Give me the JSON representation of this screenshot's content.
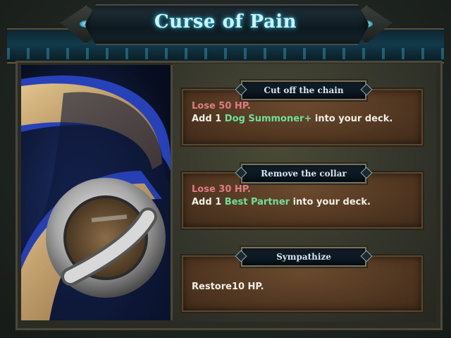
{
  "event": {
    "title": "Curse of Pain",
    "image_icon": "collar-icon"
  },
  "options": [
    {
      "label": "Cut off the chain",
      "line1": {
        "prefix": "",
        "highlight": "Lose 50 HP.",
        "suffix": ""
      },
      "line2": {
        "prefix": "Add 1 ",
        "highlight": "Dog Summoner+",
        "suffix": " into your deck."
      }
    },
    {
      "label": "Remove the collar",
      "line1": {
        "prefix": "",
        "highlight": "Lose 30 HP.",
        "suffix": ""
      },
      "line2": {
        "prefix": "Add 1 ",
        "highlight": "Best Partner",
        "suffix": " into your deck."
      }
    },
    {
      "label": "Sympathize",
      "line1": {
        "prefix": "Restore10 HP.",
        "highlight": "",
        "suffix": ""
      }
    }
  ],
  "colors": {
    "title_glow": "#2fb8d8",
    "penalty_text": "#e07b85",
    "card_name_text": "#6fe09a"
  }
}
